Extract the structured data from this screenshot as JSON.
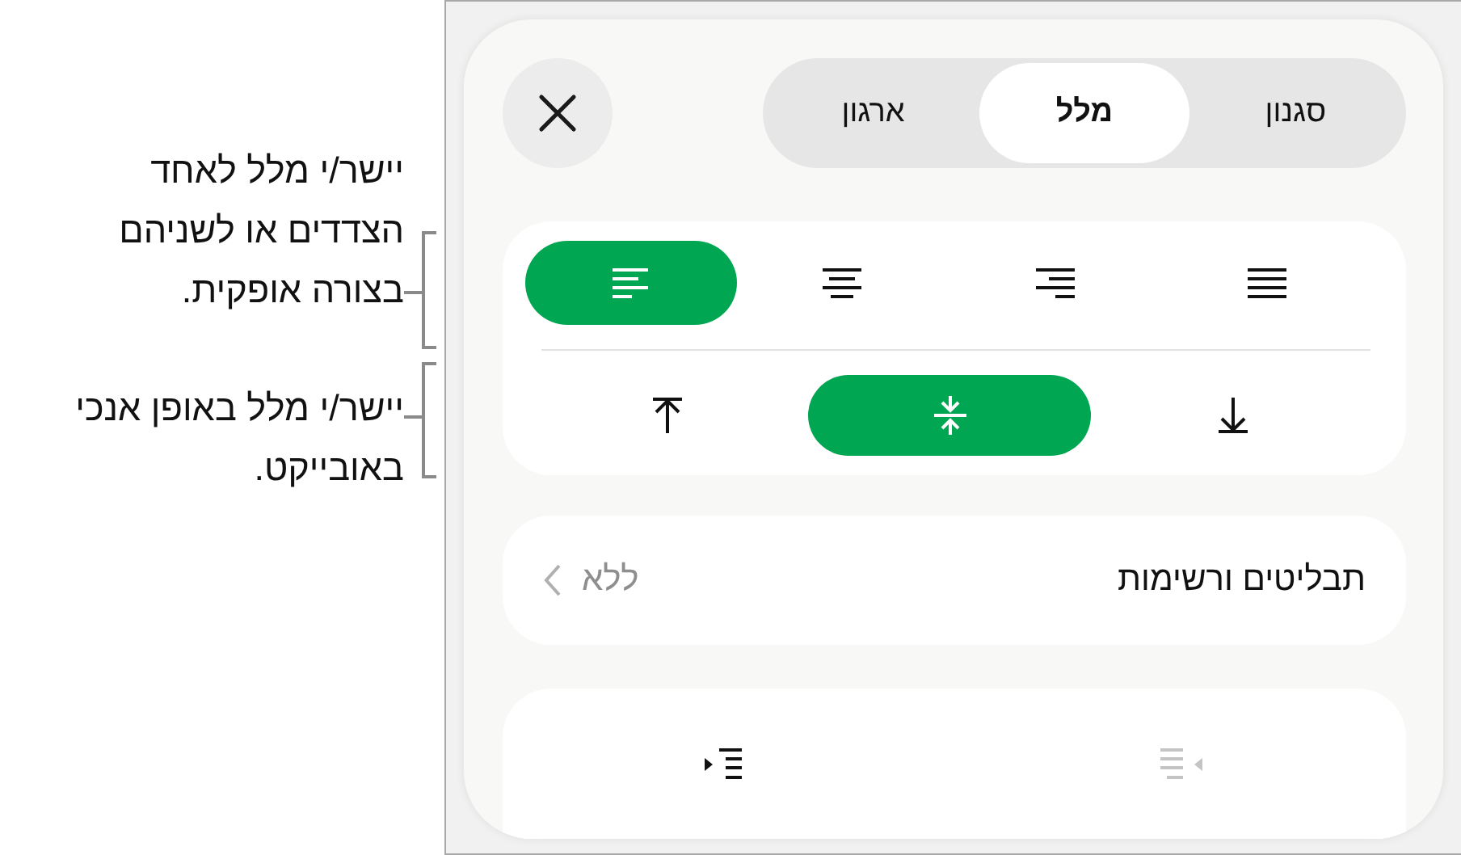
{
  "callouts": [
    {
      "text": "יישר/י מלל לאחד הצדדים או לשניהם בצורה אופקית."
    },
    {
      "text": "יישר/י מלל באופן אנכי באובייקט."
    }
  ],
  "tabs": [
    {
      "label": "סגנון",
      "selected": false
    },
    {
      "label": "מלל",
      "selected": true
    },
    {
      "label": "ארגון",
      "selected": false
    }
  ],
  "horizontal_alignment": [
    {
      "kind": "left",
      "selected": true
    },
    {
      "kind": "center",
      "selected": false
    },
    {
      "kind": "right",
      "selected": false
    },
    {
      "kind": "justify",
      "selected": false
    }
  ],
  "vertical_alignment": [
    {
      "kind": "top",
      "selected": false
    },
    {
      "kind": "middle",
      "selected": true
    },
    {
      "kind": "bottom",
      "selected": false
    }
  ],
  "list_row": {
    "label": "תבליטים ורשימות",
    "value": "ללא"
  },
  "indent_buttons": [
    {
      "kind": "increase",
      "disabled": false
    },
    {
      "kind": "decrease",
      "disabled": true
    }
  ]
}
